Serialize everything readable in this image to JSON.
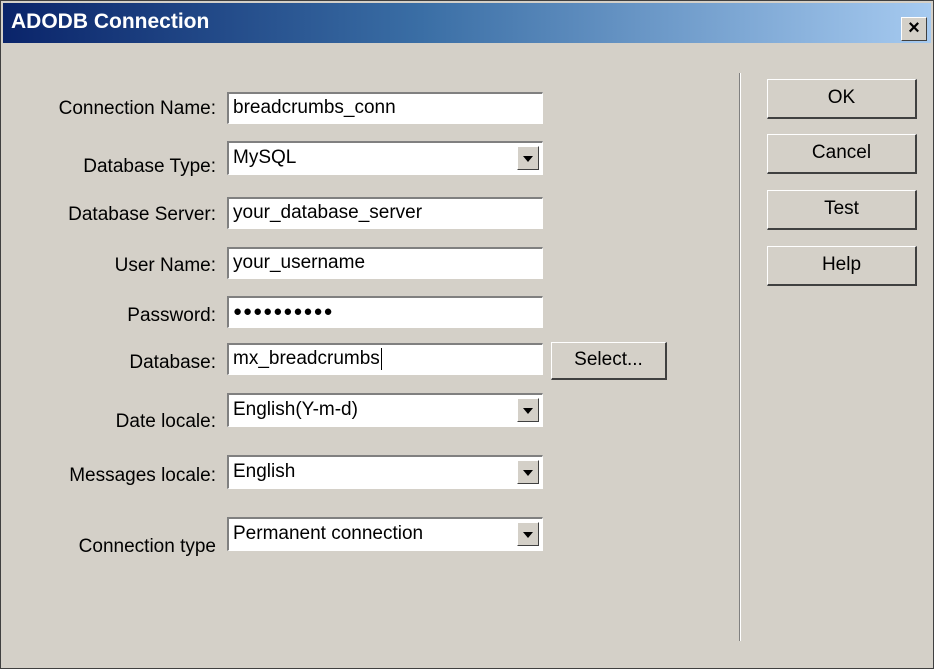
{
  "window": {
    "title": "ADODB Connection",
    "close_label": "×"
  },
  "form": {
    "connection_name": {
      "label": "Connection Name:",
      "value": "breadcrumbs_conn"
    },
    "database_type": {
      "label": "Database Type:",
      "value": "MySQL"
    },
    "database_server": {
      "label": "Database Server:",
      "value": "your_database_server"
    },
    "user_name": {
      "label": "User Name:",
      "value": "your_username"
    },
    "password": {
      "label": "Password:",
      "value": "●●●●●●●●●●"
    },
    "database": {
      "label": "Database:",
      "value": "mx_breadcrumbs",
      "select_label": "Select..."
    },
    "date_locale": {
      "label": "Date locale:",
      "value": "English(Y-m-d)"
    },
    "messages_locale": {
      "label": "Messages locale:",
      "value": "English"
    },
    "connection_type": {
      "label": "Connection type",
      "value": "Permanent connection"
    }
  },
  "buttons": {
    "ok": "OK",
    "cancel": "Cancel",
    "test": "Test",
    "help": "Help"
  },
  "colors": {
    "title_start": "#0a246a",
    "title_end": "#a6caf0",
    "face": "#d4d0c8"
  }
}
